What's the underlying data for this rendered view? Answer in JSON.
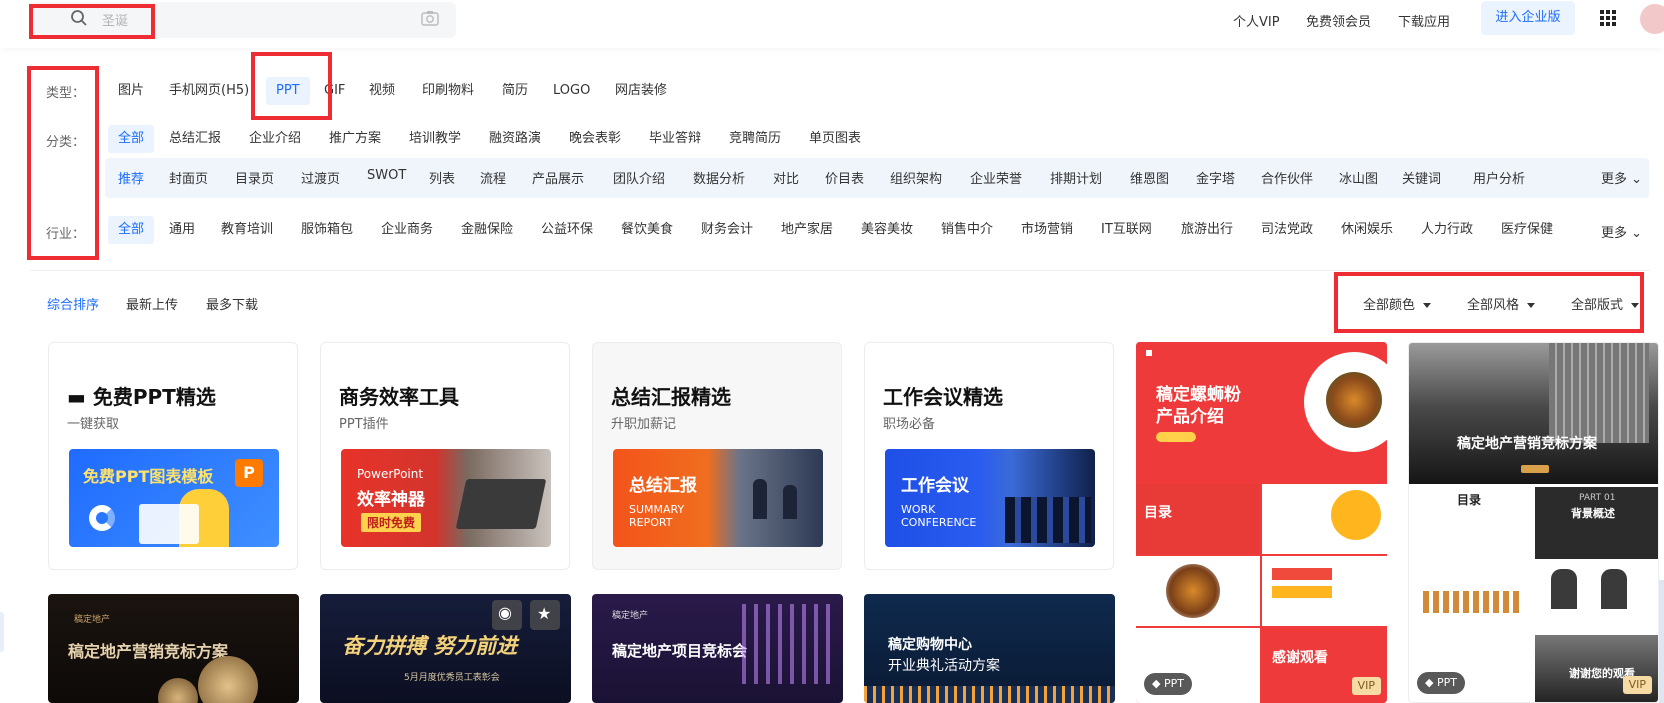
{
  "header": {
    "search_placeholder": "圣诞",
    "links": [
      "个人VIP",
      "免费领会员",
      "下载应用"
    ],
    "enterprise_button": "进入企业版"
  },
  "filters": {
    "type_label": "类型：",
    "types": [
      "图片",
      "手机网页(H5)",
      "PPT",
      "GIF",
      "视频",
      "印刷物料",
      "简历",
      "LOGO",
      "网店装修"
    ],
    "category_label": "分类：",
    "categories": [
      "全部",
      "总结汇报",
      "企业介绍",
      "推广方案",
      "培训教学",
      "融资路演",
      "晚会表彰",
      "毕业答辩",
      "竞聘简历",
      "单页图表"
    ],
    "subcategories": [
      "推荐",
      "封面页",
      "目录页",
      "过渡页",
      "SWOT",
      "列表",
      "流程",
      "产品展示",
      "团队介绍",
      "数据分析",
      "对比",
      "价目表",
      "组织架构",
      "企业荣誉",
      "排期计划",
      "维恩图",
      "金字塔",
      "合作伙伴",
      "冰山图",
      "关键词",
      "用户分析"
    ],
    "more_label": "更多",
    "industry_label": "行业：",
    "industries": [
      "全部",
      "通用",
      "教育培训",
      "服饰箱包",
      "企业商务",
      "金融保险",
      "公益环保",
      "餐饮美食",
      "财务会计",
      "地产家居",
      "美容美妆",
      "销售中介",
      "市场营销",
      "IT互联网",
      "旅游出行",
      "司法党政",
      "休闲娱乐",
      "人力行政",
      "医疗保健"
    ]
  },
  "sort": {
    "options": [
      "综合排序",
      "最新上传",
      "最多下载"
    ],
    "dropdowns": [
      "全部颜色",
      "全部风格",
      "全部版式"
    ]
  },
  "feature_cards": [
    {
      "title": "免费PPT精选",
      "subtitle": "一键获取",
      "banner": "免费PPT图表模板",
      "banner_sub": ""
    },
    {
      "title": "商务效率工具",
      "subtitle": "PPT插件",
      "banner": "效率神器",
      "banner_top": "PowerPoint",
      "banner_tag": "限时免费"
    },
    {
      "title": "总结汇报精选",
      "subtitle": "升职加薪记",
      "banner": "总结汇报",
      "banner_sub": "SUMMARY REPORT"
    },
    {
      "title": "工作会议精选",
      "subtitle": "职场必备",
      "banner": "工作会议",
      "banner_sub": "WORK CONFERENCE"
    }
  ],
  "tall_templates": [
    {
      "title": "稿定螺蛳粉\n产品介绍",
      "section": "目录",
      "closing": "感谢观看",
      "badge": "PPT",
      "vip": "VIP"
    },
    {
      "title": "稿定地产营销竞标方案",
      "section": "目录",
      "part": "PART 01",
      "part_title": "背景概述",
      "closing": "谢谢您的观看",
      "badge": "PPT",
      "vip": "VIP"
    }
  ],
  "bottom_templates": [
    {
      "title": "稿定地产营销竞标方案",
      "brand": "稿定地产"
    },
    {
      "title": "奋力拼搏 努力前进",
      "subtitle": "5月月度优秀员工表彰会"
    },
    {
      "title": "稿定地产项目竞标会",
      "brand": "稿定地产"
    },
    {
      "title": "稿定购物中心",
      "subtitle": "开业典礼活动方案"
    }
  ],
  "colors": {
    "accent": "#1a6dff",
    "highlight_box": "#ee2c33",
    "vip": "#f6dca4"
  }
}
